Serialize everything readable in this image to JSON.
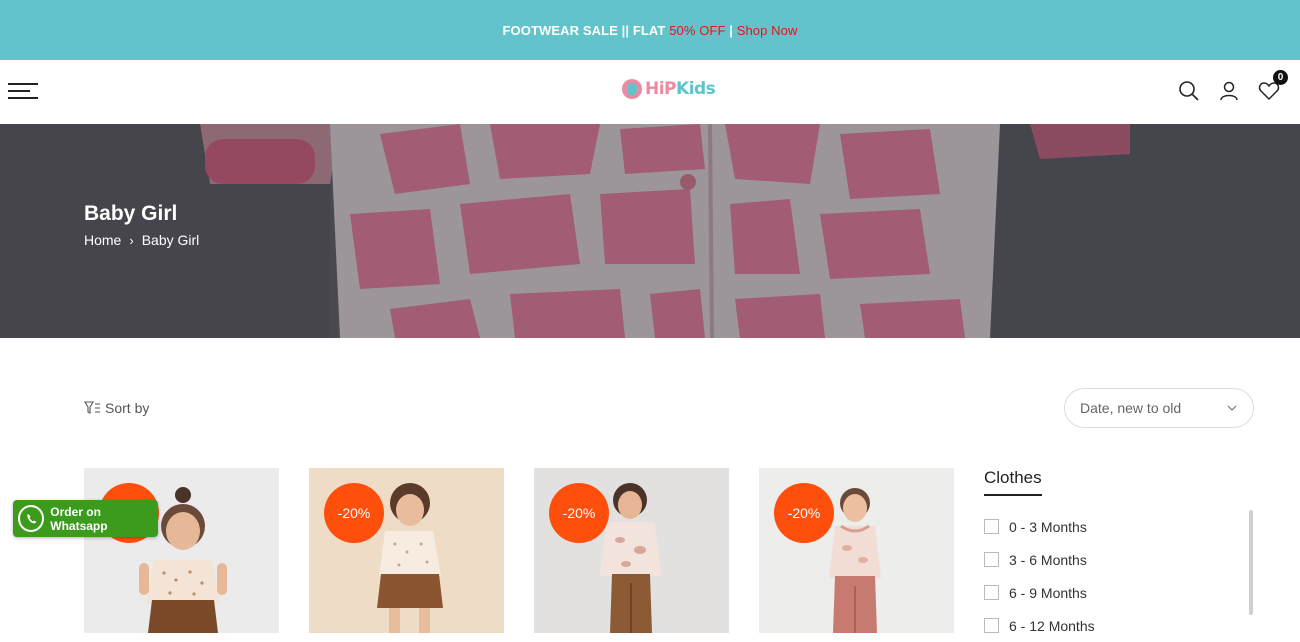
{
  "announcement": {
    "prefix": "FOOTWEAR SALE || FLAT ",
    "sale": "50% OFF",
    "sep": " | ",
    "link": "Shop Now"
  },
  "header": {
    "logo_part1": "HiP",
    "logo_part2": "Kids",
    "cart_count": "0"
  },
  "hero": {
    "title": "Baby Girl",
    "breadcrumb": [
      "Home",
      "Baby Girl"
    ]
  },
  "toolbar": {
    "sort_label": "Sort by",
    "sort_value": "Date, new to old"
  },
  "products": [
    {
      "discount": "",
      "bg": "#ebebec"
    },
    {
      "discount": "-20%",
      "bg": "#efdcc7"
    },
    {
      "discount": "-20%",
      "bg": "#e3e1e0"
    },
    {
      "discount": "-20%",
      "bg": "#ededeb"
    }
  ],
  "sidebar": {
    "title": "Clothes",
    "filters": [
      "0 - 3 Months",
      "3 - 6 Months",
      "6 - 9 Months",
      "6 - 12 Months"
    ]
  },
  "whatsapp": {
    "label": "Order on Whatsapp"
  },
  "colors": {
    "announce_bg": "#62c3cb",
    "accent_red": "#e2161b",
    "discount_badge": "#fe4f0d",
    "whatsapp_green": "#3c9b1c"
  }
}
